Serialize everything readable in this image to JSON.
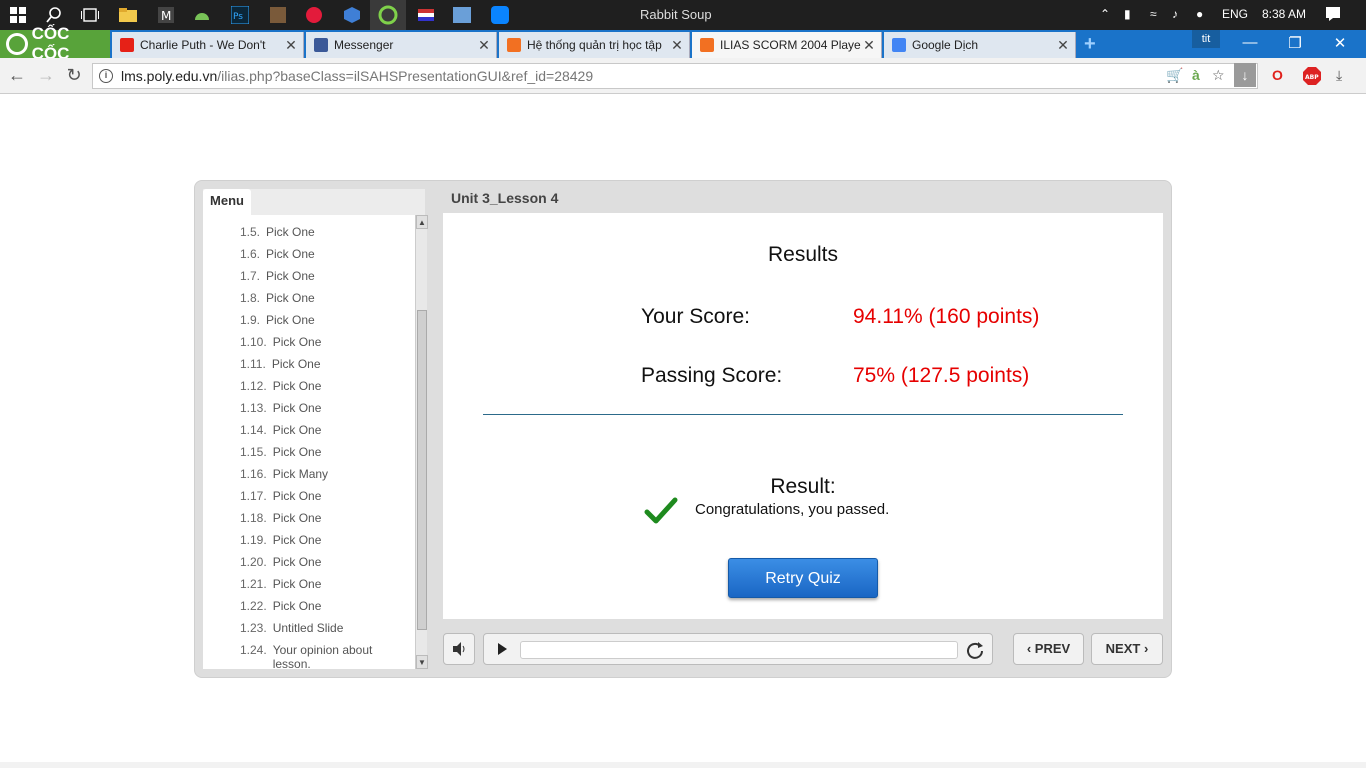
{
  "taskbar": {
    "window_title": "Rabbit Soup",
    "language": "ENG",
    "time": "8:38 AM"
  },
  "browser": {
    "brand": "CỐC CỐC",
    "tabs": [
      {
        "label": "Charlie Puth - We Don't",
        "icon": "youtube-icon",
        "color": "#e62117"
      },
      {
        "label": "Messenger",
        "icon": "facebook-icon",
        "color": "#3b5998"
      },
      {
        "label": "Hệ thống quản trị học tập",
        "icon": "fpt-icon",
        "color": "#f27022"
      },
      {
        "label": "ILIAS SCORM 2004 Player",
        "icon": "fpt-icon",
        "color": "#f27022"
      },
      {
        "label": "Google Dịch",
        "icon": "google-translate-icon",
        "color": "#4285f4"
      }
    ],
    "profile_badge": "tit",
    "url_host": "lms.poly.edu.vn",
    "url_path": "/ilias.php?baseClass=ilSAHSPresentationGUI&ref_id=28429"
  },
  "player": {
    "menu_tab": "Menu",
    "slide_title": "Unit 3_Lesson 4",
    "menu_items": [
      {
        "num": "1.5.",
        "label": "Pick One"
      },
      {
        "num": "1.6.",
        "label": "Pick One"
      },
      {
        "num": "1.7.",
        "label": "Pick One"
      },
      {
        "num": "1.8.",
        "label": "Pick One"
      },
      {
        "num": "1.9.",
        "label": "Pick One"
      },
      {
        "num": "1.10.",
        "label": "Pick One"
      },
      {
        "num": "1.11.",
        "label": "Pick One"
      },
      {
        "num": "1.12.",
        "label": "Pick One"
      },
      {
        "num": "1.13.",
        "label": "Pick One"
      },
      {
        "num": "1.14.",
        "label": "Pick One"
      },
      {
        "num": "1.15.",
        "label": "Pick One"
      },
      {
        "num": "1.16.",
        "label": "Pick Many"
      },
      {
        "num": "1.17.",
        "label": "Pick One"
      },
      {
        "num": "1.18.",
        "label": "Pick One"
      },
      {
        "num": "1.19.",
        "label": "Pick One"
      },
      {
        "num": "1.20.",
        "label": "Pick One"
      },
      {
        "num": "1.21.",
        "label": "Pick One"
      },
      {
        "num": "1.22.",
        "label": "Pick One"
      },
      {
        "num": "1.23.",
        "label": "Untitled Slide"
      },
      {
        "num": "1.24.",
        "label": "Your opinion about lesson."
      }
    ],
    "results": {
      "title": "Results",
      "your_score_label": "Your Score:",
      "your_score_value": "94.11% (160 points)",
      "passing_score_label": "Passing Score:",
      "passing_score_value": "75% (127.5 points)",
      "result_label": "Result:",
      "result_message": "Congratulations, you passed.",
      "retry_label": "Retry Quiz"
    },
    "nav": {
      "prev_label": "PREV",
      "next_label": "NEXT"
    },
    "colors": {
      "score": "#e60000",
      "check": "#1e8a1e",
      "retry_button": "#1a66c4"
    }
  }
}
